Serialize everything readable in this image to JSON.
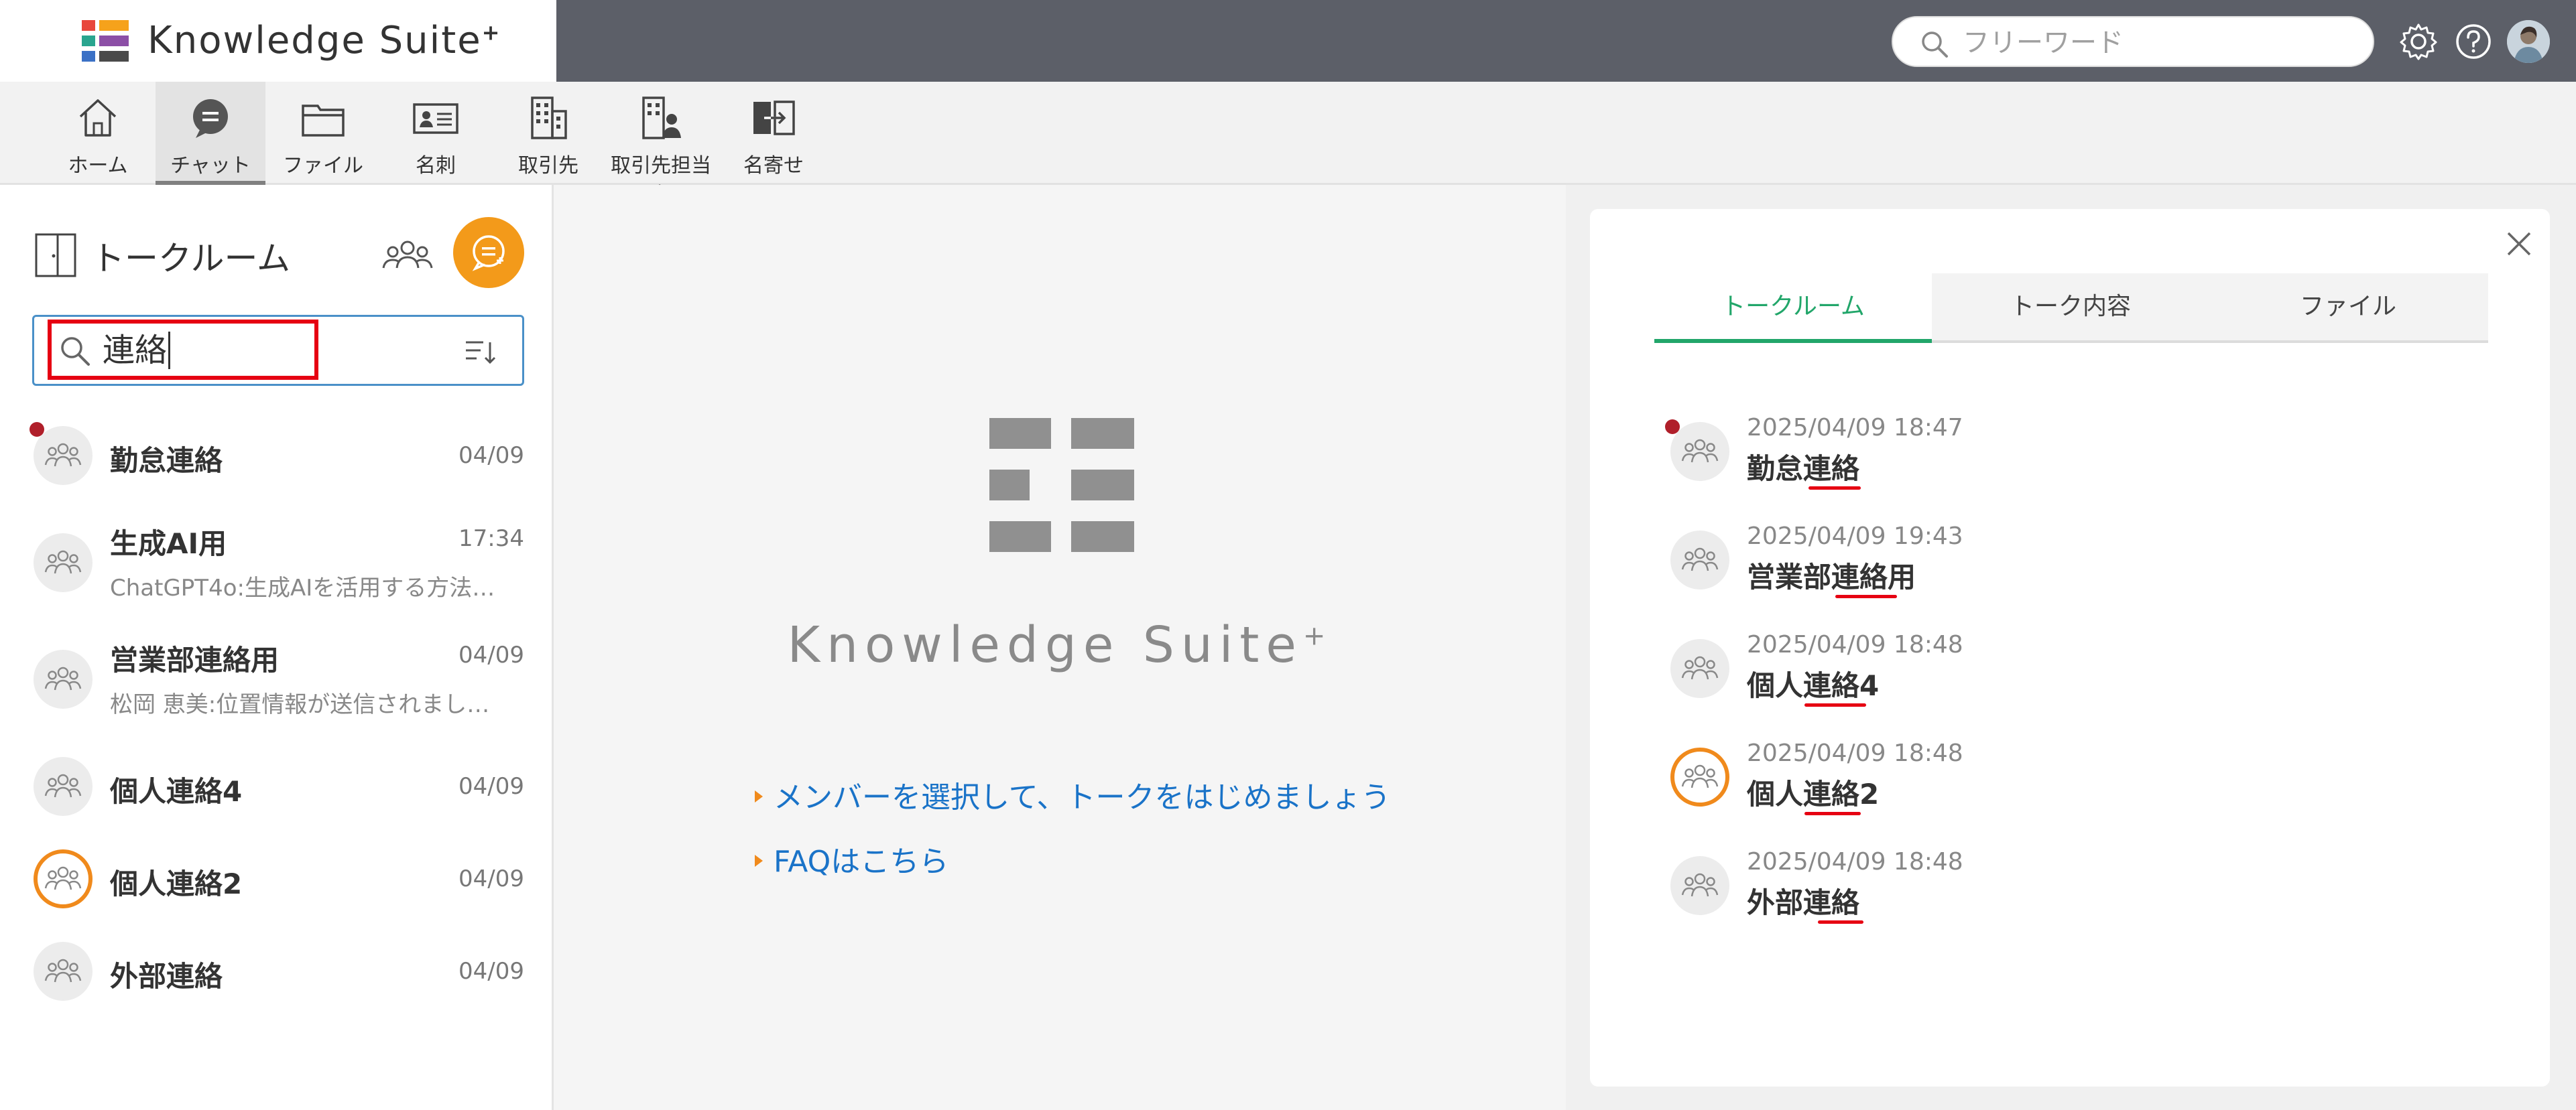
{
  "header": {
    "brand": "Knowledge Suite",
    "brand_plus": "+",
    "search_placeholder": "フリーワード"
  },
  "nav": [
    {
      "label": "ホーム",
      "icon": "home-icon"
    },
    {
      "label": "チャット",
      "icon": "chat-icon",
      "active": true
    },
    {
      "label": "ファイル",
      "icon": "folder-icon"
    },
    {
      "label": "名刺",
      "icon": "business-card-icon"
    },
    {
      "label": "取引先",
      "icon": "building-icon"
    },
    {
      "label": "取引先担当者",
      "icon": "building-person-icon"
    },
    {
      "label": "名寄せ",
      "icon": "merge-icon"
    }
  ],
  "sidebar": {
    "title": "トークルーム",
    "filter_value": "連絡",
    "rooms": [
      {
        "name": "勤怠連絡",
        "date": "04/09",
        "preview": "",
        "unread": true
      },
      {
        "name": "生成AI用",
        "date": "17:34",
        "preview": "ChatGPT4o:生成AIを活用する方法…"
      },
      {
        "name": "営業部連絡用",
        "date": "04/09",
        "preview": "松岡 恵美:位置情報が送信されまし…"
      },
      {
        "name": "個人連絡4",
        "date": "04/09",
        "preview": ""
      },
      {
        "name": "個人連絡2",
        "date": "04/09",
        "preview": "",
        "orange": true
      },
      {
        "name": "外部連絡",
        "date": "04/09",
        "preview": ""
      }
    ]
  },
  "center": {
    "brand": "Knowledge Suite",
    "brand_plus": "+",
    "link_members": "メンバーを選択して、トークをはじめましょう",
    "link_faq": "FAQはこちら"
  },
  "search_panel": {
    "tabs": [
      "トークルーム",
      "トーク内容",
      "ファイル"
    ],
    "results": [
      {
        "time": "2025/04/09 18:47",
        "name": "勤怠連絡",
        "unread": true
      },
      {
        "time": "2025/04/09 19:43",
        "name": "営業部連絡用"
      },
      {
        "time": "2025/04/09 18:48",
        "name": "個人連絡4"
      },
      {
        "time": "2025/04/09 18:48",
        "name": "個人連絡2",
        "orange": true
      },
      {
        "time": "2025/04/09 18:48",
        "name": "外部連絡"
      }
    ]
  },
  "colors": {
    "topbar": "#5c5f68",
    "accent_orange": "#f39a1a",
    "tab_active_green": "#22a66a",
    "link_blue": "#1a73c8",
    "highlight_red": "#e60012"
  }
}
